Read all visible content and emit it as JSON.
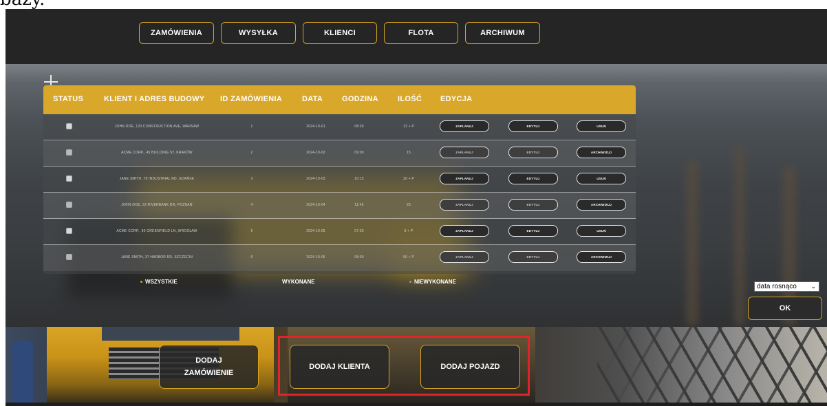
{
  "top_fragment": "bazy.",
  "nav": {
    "items": [
      {
        "label": "ZAMÓWIENIA",
        "name": "nav-zamowienia"
      },
      {
        "label": "WYSYŁKA",
        "name": "nav-wysylka"
      },
      {
        "label": "KLIENCI",
        "name": "nav-klienci"
      },
      {
        "label": "FLOTA",
        "name": "nav-flota"
      },
      {
        "label": "ARCHIWUM",
        "name": "nav-archiwum"
      }
    ]
  },
  "table": {
    "headers": [
      "STATUS",
      "KLIENT I ADRES BUDOWY",
      "ID ZAMÓWIENIA",
      "DATA",
      "GODZINA",
      "ILOŚĆ",
      "EDYCJA"
    ],
    "rows": [
      {
        "checked": false,
        "client": "JOHN DOE, 123 CONSTRUCTION AVE, WARSAW",
        "id": "1",
        "date": "2024-10-01",
        "time": "08:30",
        "qty": "12 + P",
        "b1": "ZAPLANUJ",
        "b2": "EDYTUJ",
        "b3": "USUŃ"
      },
      {
        "checked": true,
        "client": "ACME CORP., 45 BUILDING ST, KRAKÓW",
        "id": "2",
        "date": "2024-10-02",
        "time": "09:00",
        "qty": "15",
        "b1": "ZAPLANUJ",
        "b2": "EDYTUJ",
        "b3": "ARCHIWIZUJ"
      },
      {
        "checked": false,
        "client": "JANE SMITH, 78 INDUSTRIAL RD, GDAŃSK",
        "id": "3",
        "date": "2024-10-03",
        "time": "10:15",
        "qty": "20 + P",
        "b1": "ZAPLANUJ",
        "b2": "EDYTUJ",
        "b3": "USUŃ"
      },
      {
        "checked": true,
        "client": "JOHN DOE, 22 RIVERBANK DR, POZNAŃ",
        "id": "4",
        "date": "2024-10-04",
        "time": "11:45",
        "qty": "25",
        "b1": "ZAPLANUJ",
        "b2": "EDYTUJ",
        "b3": "ARCHIWIZUJ"
      },
      {
        "checked": false,
        "client": "ACME CORP., 90 GREENFIELD LN, WROCŁAW",
        "id": "5",
        "date": "2024-10-05",
        "time": "07:30",
        "qty": "8 + P",
        "b1": "ZAPLANUJ",
        "b2": "EDYTUJ",
        "b3": "USUŃ"
      },
      {
        "checked": true,
        "client": "JANE SMITH, 37 HARBOR RD, SZCZECIN",
        "id": "6",
        "date": "2024-10-06",
        "time": "08:00",
        "qty": "50 + P",
        "b1": "ZAPLANUJ",
        "b2": "EDYTUJ",
        "b3": "ARCHIWIZUJ"
      }
    ]
  },
  "filters": {
    "all": "WSZYSTKIE",
    "done": "WYKONANE",
    "undone": "NIEWYKONANE"
  },
  "sort": {
    "selected": "data rosnąco",
    "chevron": "⌄"
  },
  "ok_label": "OK",
  "actions": {
    "add_order_line1": "DODAJ",
    "add_order_line2": "ZAMÓWIENIE",
    "add_client": "DODAJ KLIENTA",
    "add_vehicle": "DODAJ POJAZD"
  },
  "colors": {
    "accent": "#d9a520",
    "header_bar": "#d9a72a",
    "highlight": "#e0242c",
    "navbar": "#252525"
  }
}
